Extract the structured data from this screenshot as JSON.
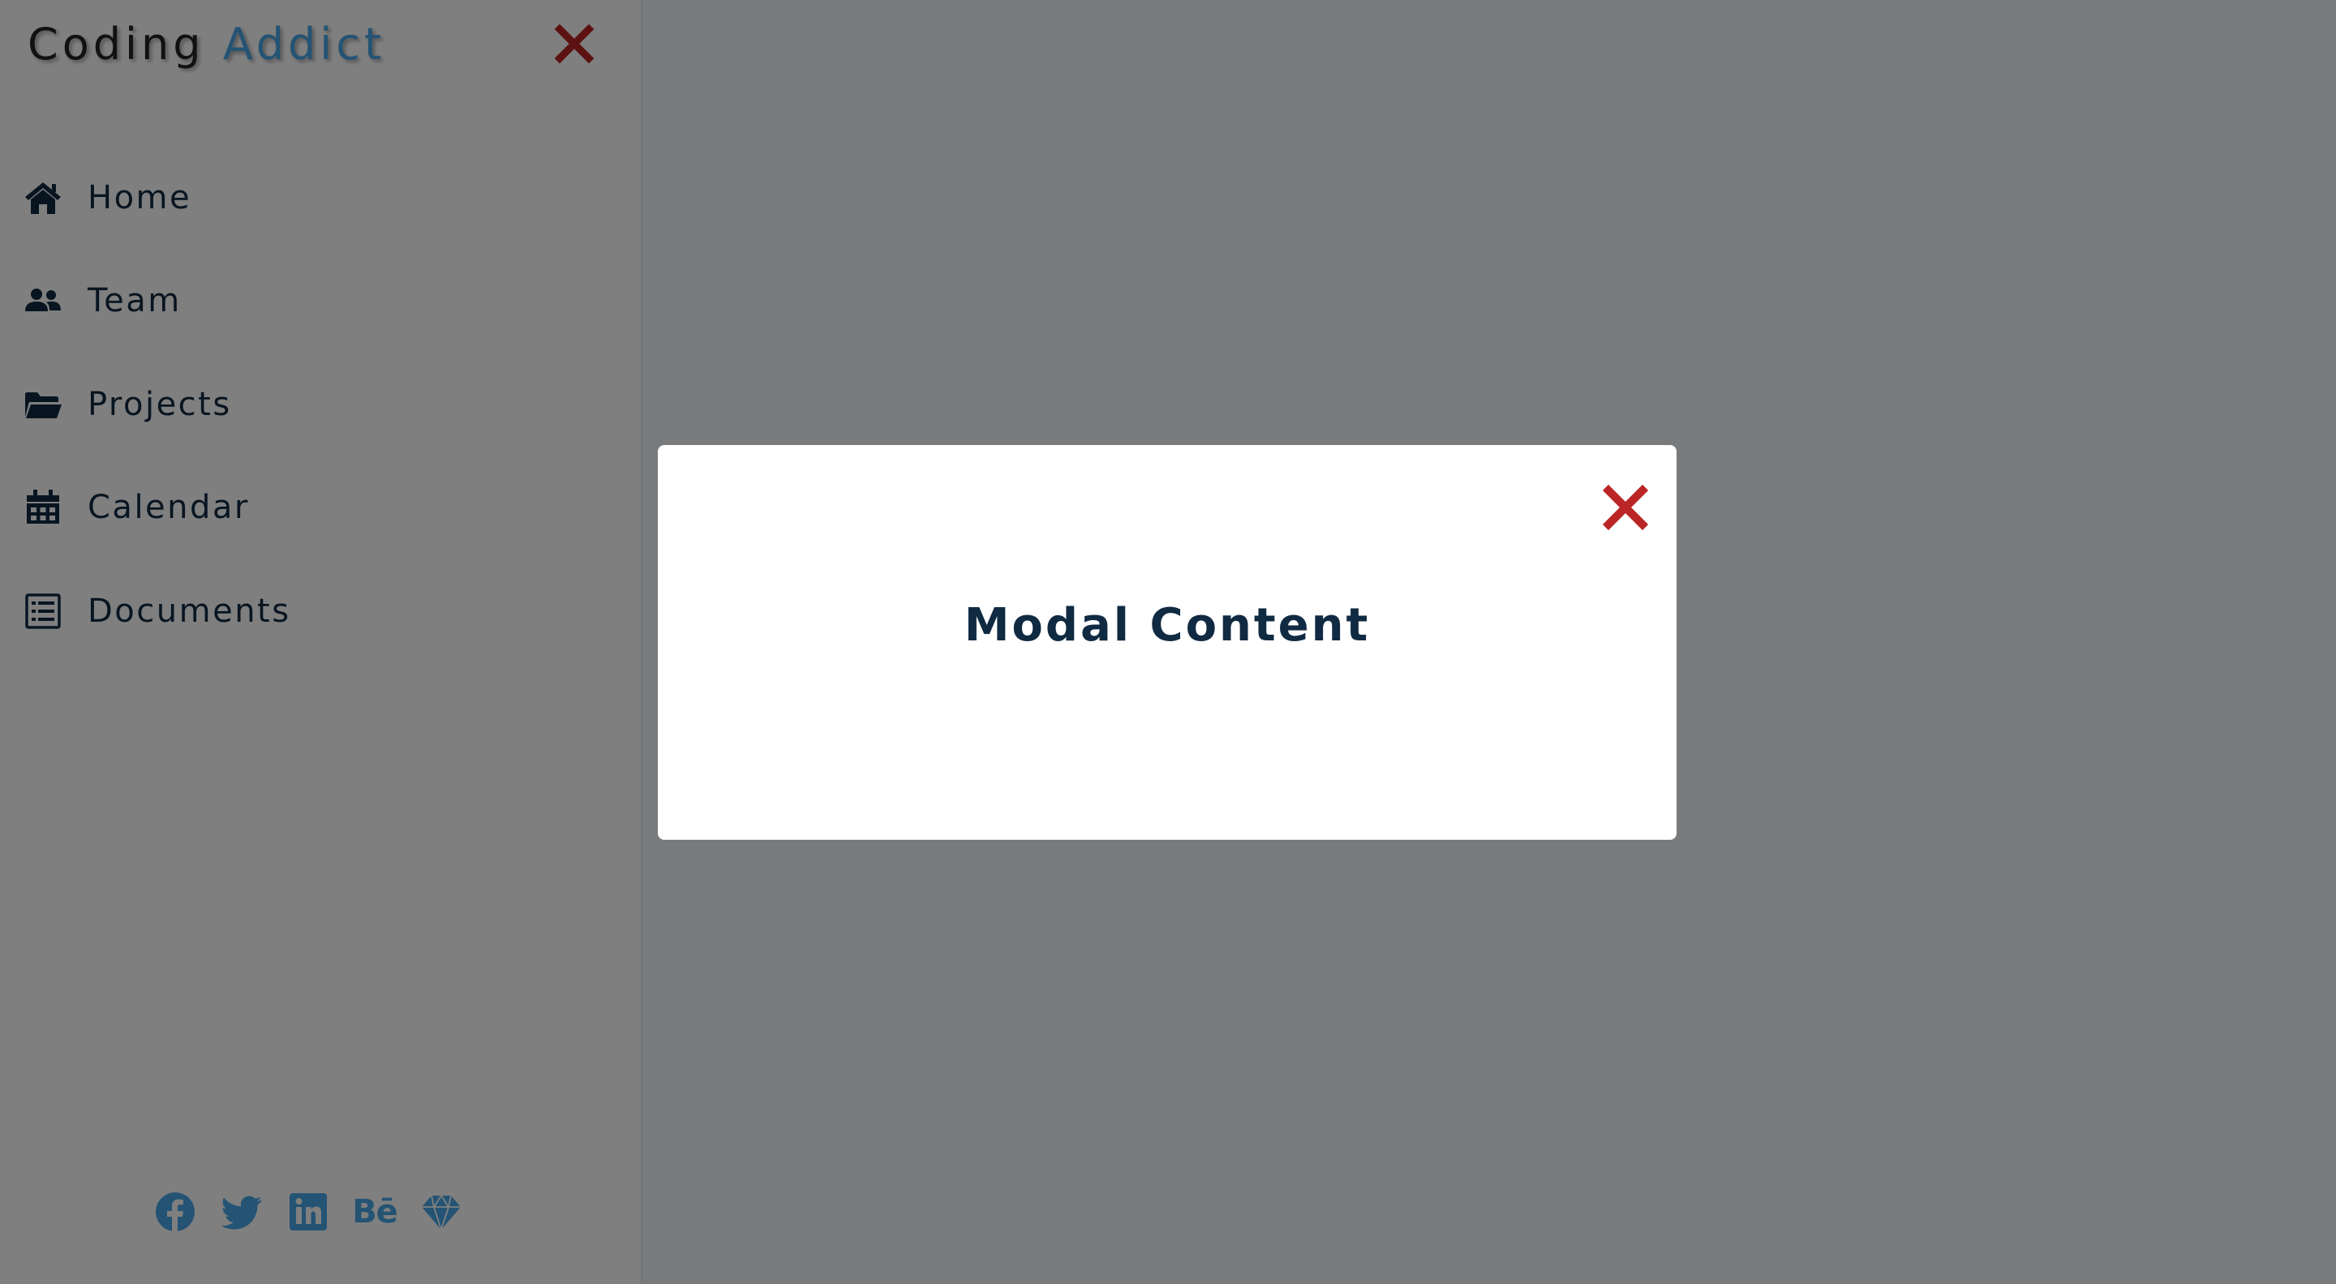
{
  "sidebar": {
    "logo": {
      "part1": "Coding",
      "part2": "Addict"
    },
    "close_icon": "close-icon",
    "links": [
      {
        "label": "Home",
        "icon": "home-icon"
      },
      {
        "label": "Team",
        "icon": "users-icon"
      },
      {
        "label": "Projects",
        "icon": "folder-open-icon"
      },
      {
        "label": "Calendar",
        "icon": "calendar-icon"
      },
      {
        "label": "Documents",
        "icon": "document-icon"
      }
    ],
    "social": [
      "facebook-icon",
      "twitter-icon",
      "linkedin-icon",
      "behance-icon",
      "sketch-icon"
    ]
  },
  "modal": {
    "title": "Modal Content",
    "close_icon": "close-icon"
  },
  "colors": {
    "primary": "#49a6e9",
    "text": "#102a42",
    "close_red": "#bb2525",
    "white": "#ffffff",
    "overlay": "rgba(0,0,0,0.5)"
  }
}
